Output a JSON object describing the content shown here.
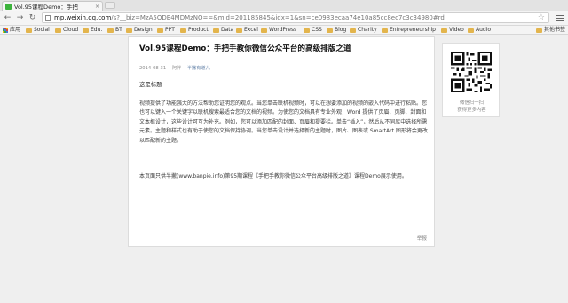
{
  "browser": {
    "tab": {
      "title": "Vol.95课程Demo：手把",
      "close": "×"
    },
    "nav": {
      "back": "←",
      "forward": "→",
      "reload": "↻"
    },
    "url": {
      "host": "mp.weixin.qq.com",
      "rest": "/s?__biz=MzA5ODE4MDMzNQ==&mid=201185845&idx=1&sn=ce0983ecaa74e10a85cc8ec7c3c34980#rd"
    },
    "star": "☆",
    "bookmarks": {
      "apps": "应用",
      "items": [
        "Social",
        "Cloud",
        "Edu.",
        "BT",
        "Design",
        "PPT",
        "Product",
        "Data",
        "Excel",
        "WordPress",
        "CSS",
        "Blog",
        "Charity",
        "Entrepreneurship",
        "Video",
        "Audio"
      ],
      "other": "其他书签"
    }
  },
  "article": {
    "title": "Vol.95课程Demo：手把手教你微信公众平台的高级排版之道",
    "date": "2014-08-31",
    "author": "阿伴",
    "source": "半撇有道儿",
    "heading": "这是标题一",
    "paragraph1": "视频提供了功能强大的方法帮助您证明您的观点。当您单击联机视频时，可以在想要添加的视频的嵌入代码中进行粘贴。您也可以键入一个关键字以联机搜索最适合您的文档的视频。为使您的文档具有专业外观，Word 提供了页眉、页脚、封面和文本框设计，这些设计可互为补充。例如，您可以添加匹配的封面、页眉和提要栏。单击“插入”，然后从不同库中选择所需元素。主题和样式也有助于使您的文档保持协调。当您单击设计并选择新的主题时，图片、图表或 SmartArt 图形将会更改以匹配新的主题。",
    "paragraph2": "本页面只供半撇(www.banpie.info)第95期课程《手把手教你微信公众平台高级排版之道》课程Demo展示使用。",
    "report": "举报"
  },
  "qrcode": {
    "line1": "微信扫一扫",
    "line2": "获得更多内容"
  }
}
